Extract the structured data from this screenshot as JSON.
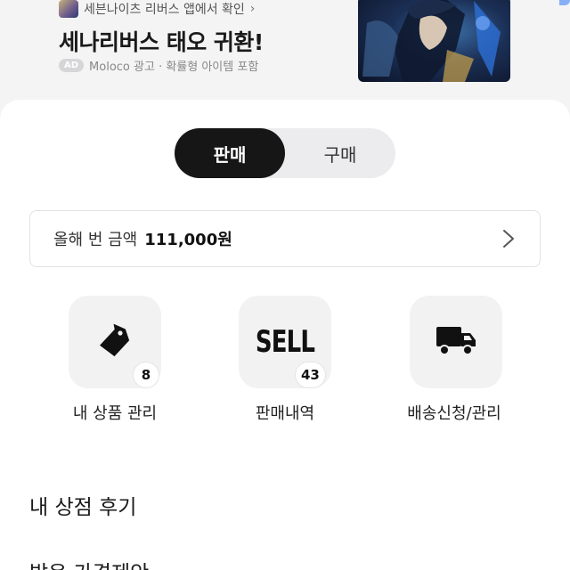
{
  "ad": {
    "source_text": "세븐나이츠 리버스 앱에서 확인",
    "source_chevron": "›",
    "title": "세나리버스 태오 귀환!",
    "badge": "AD",
    "meta": "Moloco 광고 · 확률형 아이템 포함"
  },
  "toggle": {
    "sell_label": "판매",
    "buy_label": "구매",
    "active": "sell"
  },
  "yearly_amount": {
    "label": "올해 번 금액",
    "value": "111,000원"
  },
  "tiles": [
    {
      "label": "내 상품 관리",
      "icon": "price-tag-icon",
      "badge": "8"
    },
    {
      "label": "판매내역",
      "icon": "sell-text-icon",
      "icon_text": "SELL",
      "badge": "43"
    },
    {
      "label": "배송신청/관리",
      "icon": "delivery-truck-icon"
    }
  ],
  "sections": {
    "reviews_title": "내 상점 후기",
    "offers_title": "받은 가격제안"
  },
  "colors": {
    "active_toggle": "#161616",
    "tile_bg": "#f2f2f3",
    "page_bg": "#f4f4f5"
  }
}
